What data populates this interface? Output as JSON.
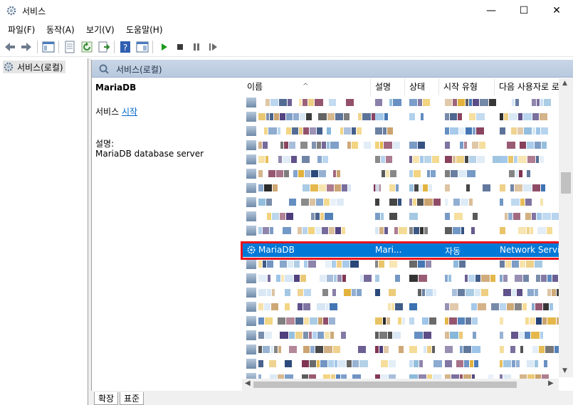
{
  "window": {
    "title": "서비스",
    "min_glyph": "—",
    "max_glyph": "☐",
    "close_glyph": "✕"
  },
  "menu": [
    "파일(F)",
    "동작(A)",
    "보기(V)",
    "도움말(H)"
  ],
  "tree": {
    "root_label": "서비스(로컬)"
  },
  "pane": {
    "header_title": "서비스(로컬)"
  },
  "detail": {
    "service_name": "MariaDB",
    "start_prefix": "서비스 ",
    "start_link": "시작",
    "description_label": "설명:",
    "description_text": "MariaDB database server"
  },
  "columns": [
    "이름",
    "설명",
    "상태",
    "시작 유형",
    "다음 사용자로 로"
  ],
  "selected_row": {
    "name": "MariaDB",
    "description": "Mari...",
    "status": "",
    "startup_type": "자동",
    "log_on_as": "Network Service"
  },
  "tabs": [
    "확장",
    "표준"
  ],
  "colors": {
    "selection": "#0078d7",
    "highlight_box": "#e8121d",
    "link": "#0066cc"
  }
}
